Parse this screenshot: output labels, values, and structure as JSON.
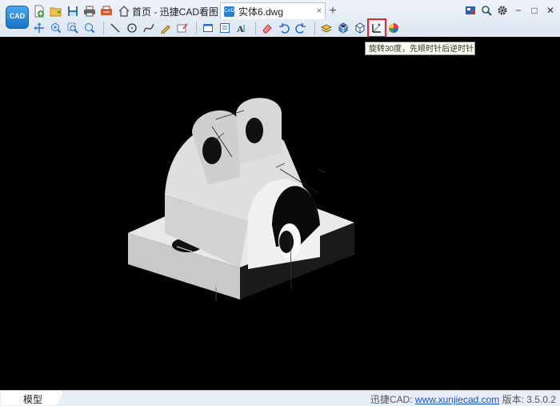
{
  "app": {
    "logo_text": "CAD",
    "home_tab_label": "首页 - 迅捷CAD看图",
    "doc_tab_label": "实体6.dwg",
    "doc_tab_badge": "CAD",
    "doc_tab_close": "×",
    "new_tab": "+"
  },
  "quick_toolbar": [
    {
      "name": "new-file-icon",
      "color": "#3a9a3a"
    },
    {
      "name": "open-folder-icon",
      "color": "#e0a42a"
    },
    {
      "name": "save-icon",
      "color": "#2f6fb5"
    },
    {
      "name": "print-icon",
      "color": "#555555"
    },
    {
      "name": "batch-print-icon",
      "color": "#d95b2a"
    }
  ],
  "window_controls": {
    "minimize": "−",
    "maximize": "□",
    "close": "✕"
  },
  "tooltip": "旋转30度，先顺时针后逆时针",
  "status": {
    "model_tab": "模型",
    "brand_prefix": "迅捷CAD: ",
    "website": "www.xunjiecad.com",
    "version": " 版本: 3.5.0.2"
  },
  "colors": {
    "canvas_bg": "#000000",
    "highlight_border": "#e42a2a",
    "link": "#1a56c8"
  }
}
